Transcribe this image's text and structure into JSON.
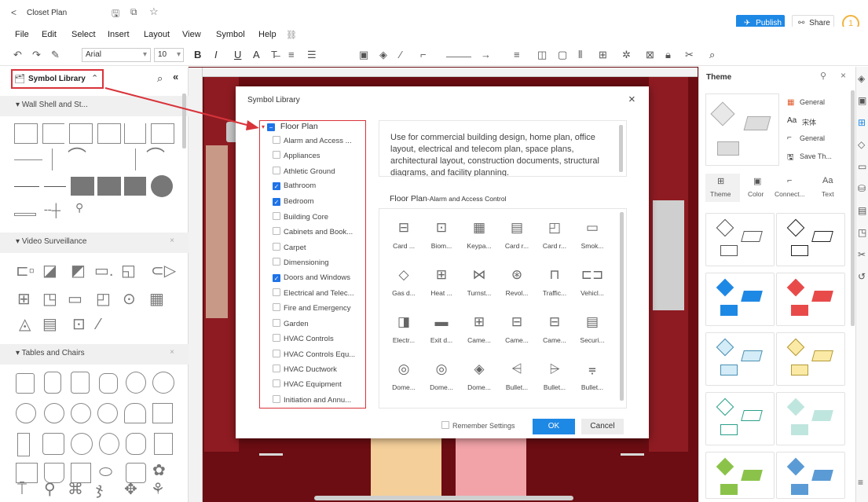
{
  "titlebar": {
    "back_glyph": "<",
    "title": "Closet Plan",
    "publish_label": "Publish",
    "share_label": "Share",
    "avatar_text": "1"
  },
  "menu": [
    "File",
    "Edit",
    "Select",
    "Insert",
    "Layout",
    "View",
    "Symbol",
    "Help"
  ],
  "toolbar": {
    "font_family": "Arial",
    "font_size": "10"
  },
  "left_panel": {
    "title": "Symbol Library",
    "sections": [
      {
        "label": "Wall Shell and St..."
      },
      {
        "label": "Video Surveillance"
      },
      {
        "label": "Tables and Chairs"
      }
    ]
  },
  "dialog": {
    "title": "Symbol Library",
    "close_glyph": "×",
    "tree_root": "Floor Plan",
    "tree_items": [
      {
        "label": "Alarm and Access ...",
        "checked": false
      },
      {
        "label": "Appliances",
        "checked": false
      },
      {
        "label": "Athletic Ground",
        "checked": false
      },
      {
        "label": "Bathroom",
        "checked": true
      },
      {
        "label": "Bedroom",
        "checked": true
      },
      {
        "label": "Building Core",
        "checked": false
      },
      {
        "label": "Cabinets and Book...",
        "checked": false
      },
      {
        "label": "Carpet",
        "checked": false
      },
      {
        "label": "Dimensioning",
        "checked": false
      },
      {
        "label": "Doors and Windows",
        "checked": true
      },
      {
        "label": "Electrical and Telec...",
        "checked": false
      },
      {
        "label": "Fire and Emergency",
        "checked": false
      },
      {
        "label": "Garden",
        "checked": false
      },
      {
        "label": "HVAC Controls",
        "checked": false
      },
      {
        "label": "HVAC Controls Equ...",
        "checked": false
      },
      {
        "label": "HVAC Ductwork",
        "checked": false
      },
      {
        "label": "HVAC Equipment",
        "checked": false
      },
      {
        "label": "Initiation and Annu...",
        "checked": false
      }
    ],
    "description": "Use for commercial building design, home plan, office layout, electrical and telecom plan, space plans, architectural layout, construction documents, structural diagrams, and facility planning.",
    "category_title": "Floor Plan",
    "category_subtitle": "-Alarm and Access Control",
    "icons": [
      [
        "Card ...",
        "Biom...",
        "Keypa...",
        "Card r...",
        "Card r...",
        "Smok..."
      ],
      [
        "Gas d...",
        "Heat ...",
        "Turnst...",
        "Revol...",
        "Traffic...",
        "Vehicl..."
      ],
      [
        "Electr...",
        "Exit d...",
        "Came...",
        "Came...",
        "Came...",
        "Securi..."
      ],
      [
        "Dome...",
        "Dome...",
        "Dome...",
        "Bullet...",
        "Bullet...",
        "Bullet..."
      ]
    ],
    "remember_label": "Remember Settings",
    "ok_label": "OK",
    "cancel_label": "Cancel"
  },
  "right_panel": {
    "title": "Theme",
    "options": [
      "General",
      "宋体",
      "General",
      "Save Th..."
    ],
    "tabs": [
      "Theme",
      "Color",
      "Connect...",
      "Text"
    ]
  },
  "colors": {
    "accent": "#1e88e5",
    "highlight": "#d8333a",
    "canvas": "#6b0d12"
  }
}
